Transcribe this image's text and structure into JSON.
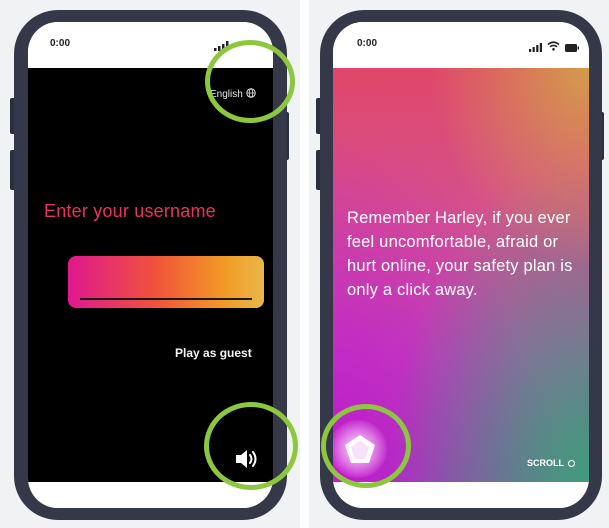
{
  "left_phone": {
    "status_time": "0:00",
    "language_label": "English",
    "prompt": "Enter your username",
    "username_value": "",
    "guest_label": "Play as guest",
    "icons": {
      "language": "globe-icon",
      "sound": "speaker-icon"
    }
  },
  "right_phone": {
    "status_time": "0:00",
    "message": "Remember Harley, if you ever feel uncomfortable, afraid or hurt online, your safety plan is only a click away.",
    "scroll_label": "SCROLL",
    "icons": {
      "safety_plan": "pentagon-icon",
      "signal": "signal-icon",
      "wifi": "wifi-icon",
      "battery": "battery-icon"
    }
  },
  "colors": {
    "highlight_ring": "#8dc63f",
    "prompt_text": "#e8335d",
    "phone_frame": "#353848"
  }
}
